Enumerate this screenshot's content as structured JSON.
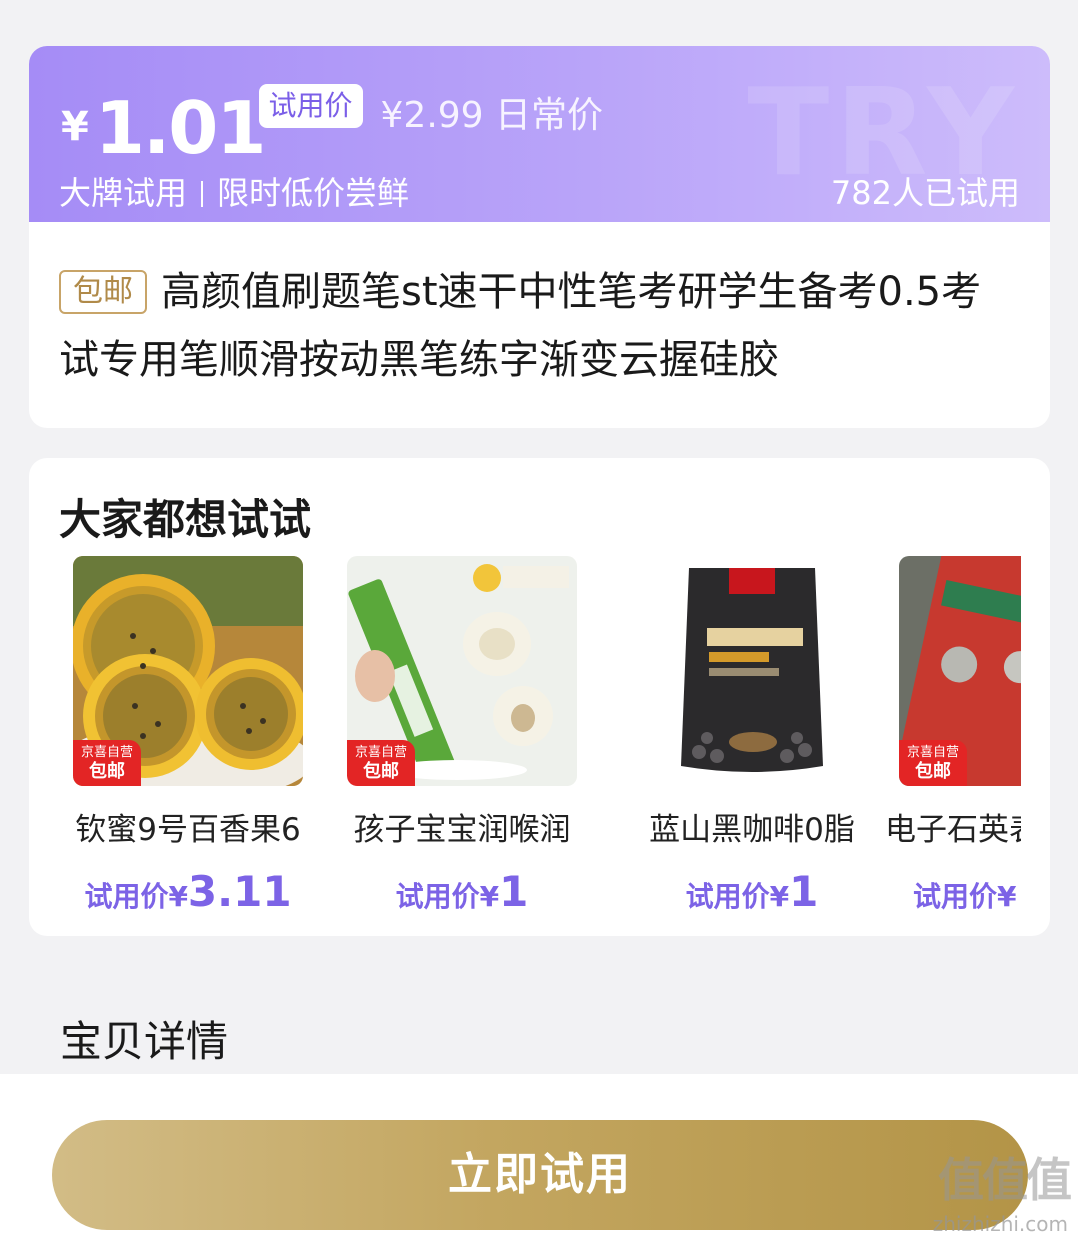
{
  "price_card": {
    "currency": "¥",
    "trial_price": "1.01",
    "trial_price_label": "试用价",
    "daily_price": "¥2.99 日常价",
    "subtitle_left": "大牌试用",
    "subtitle_right": "限时低价尝鲜",
    "trial_count": "782人已试用",
    "watermark": "TRY",
    "shipping_badge": "包邮",
    "product_title": "高颜值刷题笔st速干中性笔考研学生备考0.5考试专用笔顺滑按动黑笔练字渐变云握硅胶"
  },
  "recommend": {
    "title": "大家都想试试",
    "items": [
      {
        "name": "钦蜜9号百香果6",
        "price_label": "试用价¥",
        "price": "3.11",
        "badge_line1": "京喜自营",
        "badge_line2": "包邮",
        "image_icon": "passion-fruit-image"
      },
      {
        "name": "孩子宝宝润喉润",
        "price_label": "试用价¥",
        "price": "1",
        "badge_line1": "京喜自营",
        "badge_line2": "包邮",
        "image_icon": "pear-drink-image"
      },
      {
        "name": "蓝山黑咖啡0脂",
        "price_label": "试用价¥",
        "price": "1",
        "badge_line1": "",
        "badge_line2": "",
        "image_icon": "black-coffee-image"
      },
      {
        "name": "电子石英表",
        "price_label": "试用价¥",
        "price": "",
        "badge_line1": "京喜自营",
        "badge_line2": "包邮",
        "image_icon": "battery-image"
      }
    ]
  },
  "detail": {
    "title": "宝贝详情"
  },
  "cta": {
    "label": "立即试用"
  },
  "watermark_logo": {
    "text": "值值值",
    "url": "zhizhizhi.com"
  },
  "colors": {
    "banner": "#a58cf6",
    "accent_price": "#7c63e6",
    "cta_gold": "#c3a660",
    "store_badge": "#e32525"
  }
}
